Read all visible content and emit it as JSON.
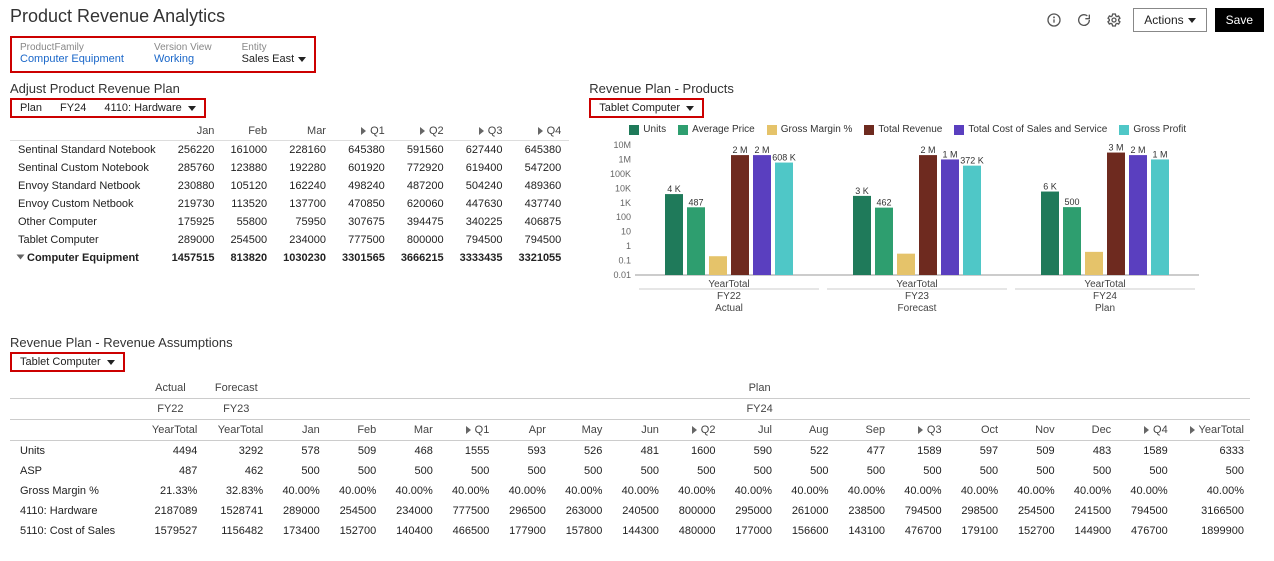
{
  "header": {
    "title": "Product Revenue Analytics",
    "actions_label": "Actions",
    "save_label": "Save"
  },
  "context": {
    "product_family_label": "ProductFamily",
    "product_family_value": "Computer Equipment",
    "version_view_label": "Version View",
    "version_view_value": "Working",
    "entity_label": "Entity",
    "entity_value": "Sales East"
  },
  "adjust": {
    "title": "Adjust Product Revenue Plan",
    "plan_label": "Plan",
    "fy_label": "FY24",
    "account_label": "4110: Hardware",
    "columns": [
      "Jan",
      "Feb",
      "Mar",
      "Q1",
      "Q2",
      "Q3",
      "Q4"
    ],
    "rows": [
      {
        "name": "Sentinal Standard Notebook",
        "v": [
          "256220",
          "161000",
          "228160",
          "645380",
          "591560",
          "627440",
          "645380"
        ]
      },
      {
        "name": "Sentinal Custom Notebook",
        "v": [
          "285760",
          "123880",
          "192280",
          "601920",
          "772920",
          "619400",
          "547200"
        ]
      },
      {
        "name": "Envoy Standard Netbook",
        "v": [
          "230880",
          "105120",
          "162240",
          "498240",
          "487200",
          "504240",
          "489360"
        ]
      },
      {
        "name": "Envoy Custom Netbook",
        "v": [
          "219730",
          "113520",
          "137700",
          "470850",
          "620060",
          "447630",
          "437740"
        ]
      },
      {
        "name": "Other Computer",
        "v": [
          "175925",
          "55800",
          "75950",
          "307675",
          "394475",
          "340225",
          "406875"
        ]
      },
      {
        "name": "Tablet Computer",
        "v": [
          "289000",
          "254500",
          "234000",
          "777500",
          "800000",
          "794500",
          "794500"
        ]
      }
    ],
    "total_row": {
      "name": "Computer Equipment",
      "v": [
        "1457515",
        "813820",
        "1030230",
        "3301565",
        "3666215",
        "3333435",
        "3321055"
      ]
    }
  },
  "chart": {
    "title": "Revenue Plan - Products",
    "pov": "Tablet Computer",
    "legend": [
      "Units",
      "Average Price",
      "Gross Margin %",
      "Total Revenue",
      "Total Cost of Sales and Service",
      "Gross Profit"
    ],
    "colors": [
      "#1f7a5a",
      "#2e9e6f",
      "#e5c36a",
      "#6e2a1f",
      "#5a3fbf",
      "#4fc7c7"
    ],
    "groups": [
      {
        "top": "YearTotal",
        "bottom": "FY22",
        "sub": "Actual",
        "labels": [
          "4 K",
          "487",
          "",
          "2 M",
          "2 M",
          "608 K"
        ]
      },
      {
        "top": "YearTotal",
        "bottom": "FY23",
        "sub": "Forecast",
        "labels": [
          "3 K",
          "462",
          "",
          "2 M",
          "1 M",
          "372 K"
        ]
      },
      {
        "top": "YearTotal",
        "bottom": "FY24",
        "sub": "Plan",
        "labels": [
          "6 K",
          "500",
          "",
          "3 M",
          "2 M",
          "1 M"
        ]
      }
    ]
  },
  "chart_data": {
    "type": "bar",
    "yscale": "log",
    "ylim": [
      0.01,
      10000000
    ],
    "series_names": [
      "Units",
      "Average Price",
      "Gross Margin %",
      "Total Revenue",
      "Total Cost of Sales and Service",
      "Gross Profit"
    ],
    "categories": [
      {
        "scenario": "Actual",
        "year": "FY22",
        "period": "YearTotal",
        "values": [
          4000,
          487,
          0.2,
          2000000,
          2000000,
          608000
        ]
      },
      {
        "scenario": "Forecast",
        "year": "FY23",
        "period": "YearTotal",
        "values": [
          3000,
          462,
          0.3,
          2000000,
          1000000,
          372000
        ]
      },
      {
        "scenario": "Plan",
        "year": "FY24",
        "period": "YearTotal",
        "values": [
          6000,
          500,
          0.4,
          3000000,
          2000000,
          1000000
        ]
      }
    ]
  },
  "assumptions": {
    "title": "Revenue Plan - Revenue Assumptions",
    "pov": "Tablet Computer",
    "scenario_labels": {
      "actual": "Actual",
      "forecast": "Forecast",
      "plan": "Plan"
    },
    "year_labels": {
      "fy22": "FY22",
      "fy23": "FY23",
      "fy24": "FY24"
    },
    "period_labels": {
      "yt": "YearTotal",
      "jan": "Jan",
      "feb": "Feb",
      "mar": "Mar",
      "q1": "Q1",
      "apr": "Apr",
      "may": "May",
      "jun": "Jun",
      "q2": "Q2",
      "jul": "Jul",
      "aug": "Aug",
      "sep": "Sep",
      "q3": "Q3",
      "oct": "Oct",
      "nov": "Nov",
      "dec": "Dec",
      "q4": "Q4",
      "ytplan": "YearTotal"
    },
    "rows": [
      {
        "name": "Units",
        "v": [
          "4494",
          "3292",
          "578",
          "509",
          "468",
          "1555",
          "593",
          "526",
          "481",
          "1600",
          "590",
          "522",
          "477",
          "1589",
          "597",
          "509",
          "483",
          "1589",
          "6333"
        ]
      },
      {
        "name": "ASP",
        "v": [
          "487",
          "462",
          "500",
          "500",
          "500",
          "500",
          "500",
          "500",
          "500",
          "500",
          "500",
          "500",
          "500",
          "500",
          "500",
          "500",
          "500",
          "500",
          "500"
        ]
      },
      {
        "name": "Gross Margin %",
        "v": [
          "21.33%",
          "32.83%",
          "40.00%",
          "40.00%",
          "40.00%",
          "40.00%",
          "40.00%",
          "40.00%",
          "40.00%",
          "40.00%",
          "40.00%",
          "40.00%",
          "40.00%",
          "40.00%",
          "40.00%",
          "40.00%",
          "40.00%",
          "40.00%",
          "40.00%"
        ]
      },
      {
        "name": "4110: Hardware",
        "v": [
          "2187089",
          "1528741",
          "289000",
          "254500",
          "234000",
          "777500",
          "296500",
          "263000",
          "240500",
          "800000",
          "295000",
          "261000",
          "238500",
          "794500",
          "298500",
          "254500",
          "241500",
          "794500",
          "3166500"
        ]
      },
      {
        "name": "5110: Cost of Sales",
        "v": [
          "1579527",
          "1156482",
          "173400",
          "152700",
          "140400",
          "466500",
          "177900",
          "157800",
          "144300",
          "480000",
          "177000",
          "156600",
          "143100",
          "476700",
          "179100",
          "152700",
          "144900",
          "476700",
          "1899900"
        ]
      }
    ]
  }
}
